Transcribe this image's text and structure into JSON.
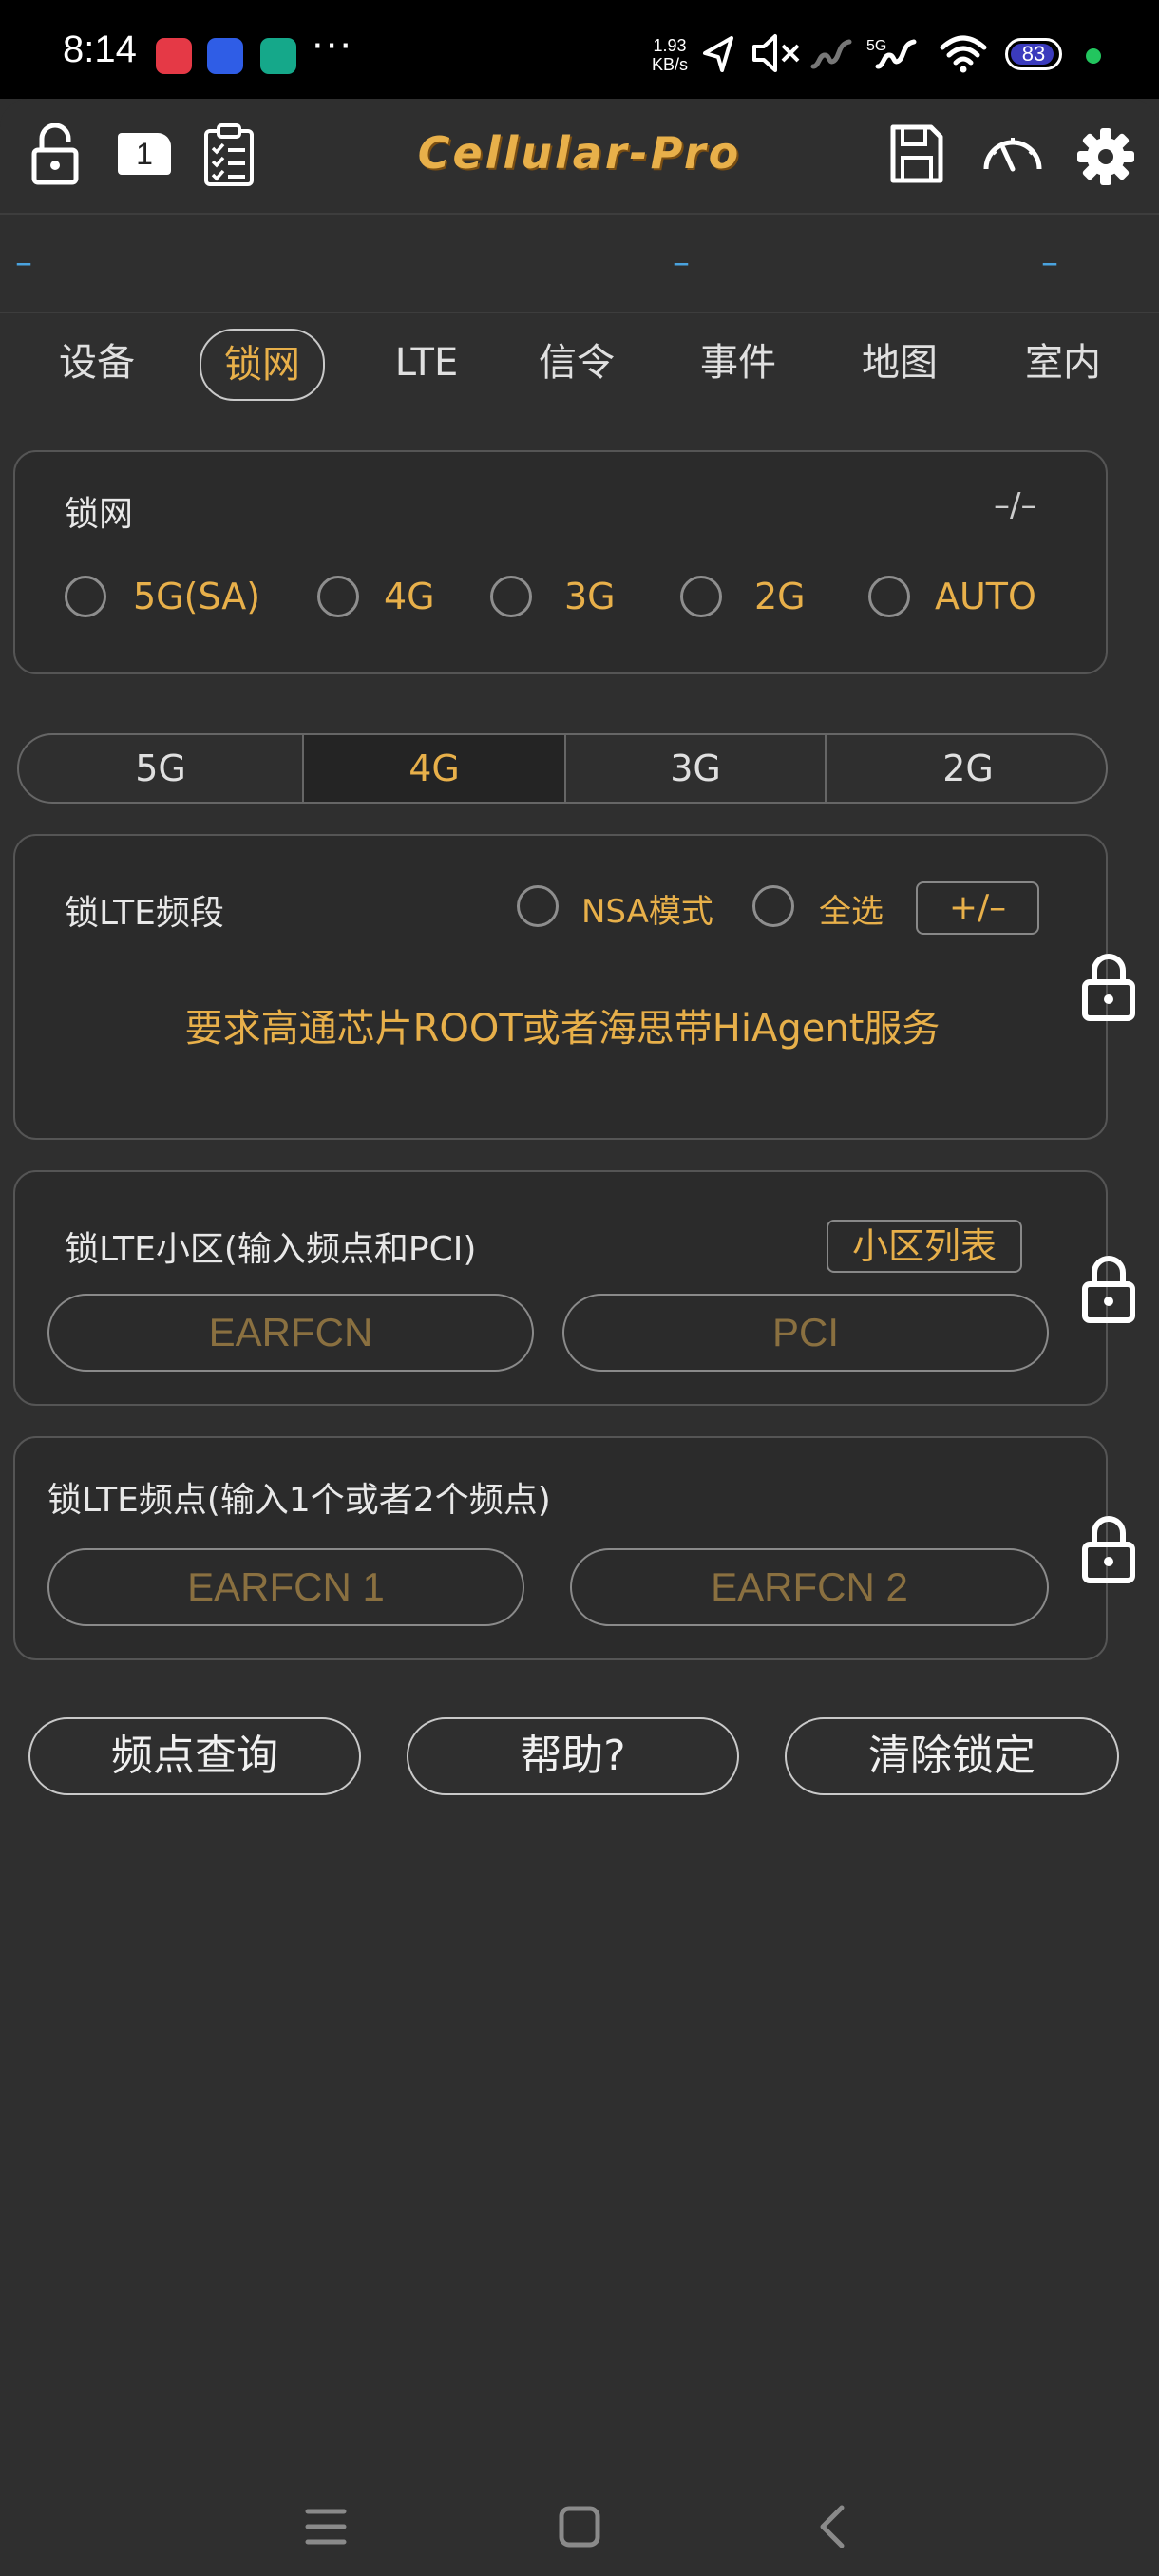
{
  "status_bar": {
    "time": "8:14",
    "net_speed_value": "1.93",
    "net_speed_unit": "KB/s",
    "battery": "83",
    "signal_tag": "5G"
  },
  "app": {
    "title": "Cellular-Pro",
    "accent_color": "#e8b04a",
    "sim_slot": "1"
  },
  "tabs": [
    {
      "label": "设备"
    },
    {
      "label": "锁网"
    },
    {
      "label": "LTE"
    },
    {
      "label": "信令"
    },
    {
      "label": "事件"
    },
    {
      "label": "地图"
    },
    {
      "label": "室内"
    }
  ],
  "info": {
    "dash1": "–",
    "dash2": "–",
    "dash3": "–"
  },
  "lock_net": {
    "title": "锁网",
    "status": "–/–",
    "options": [
      "5G(SA)",
      "4G",
      "3G",
      "2G",
      "AUTO"
    ]
  },
  "segments": [
    "5G",
    "4G",
    "3G",
    "2G"
  ],
  "lte_band": {
    "title": "锁LTE频段",
    "nsa_label": "NSA模式",
    "all_label": "全选",
    "toggle_label": "+/–",
    "notice": "要求高通芯片ROOT或者海思带HiAgent服务"
  },
  "lte_cell": {
    "title": "锁LTE小区(输入频点和PCI)",
    "list_button": "小区列表",
    "earfcn_placeholder": "EARFCN",
    "pci_placeholder": "PCI"
  },
  "lte_freq": {
    "title": "锁LTE频点(输入1个或者2个频点)",
    "earfcn1_placeholder": "EARFCN 1",
    "earfcn2_placeholder": "EARFCN 2"
  },
  "actions": {
    "query": "频点查询",
    "help": "帮助?",
    "clear": "清除锁定"
  }
}
